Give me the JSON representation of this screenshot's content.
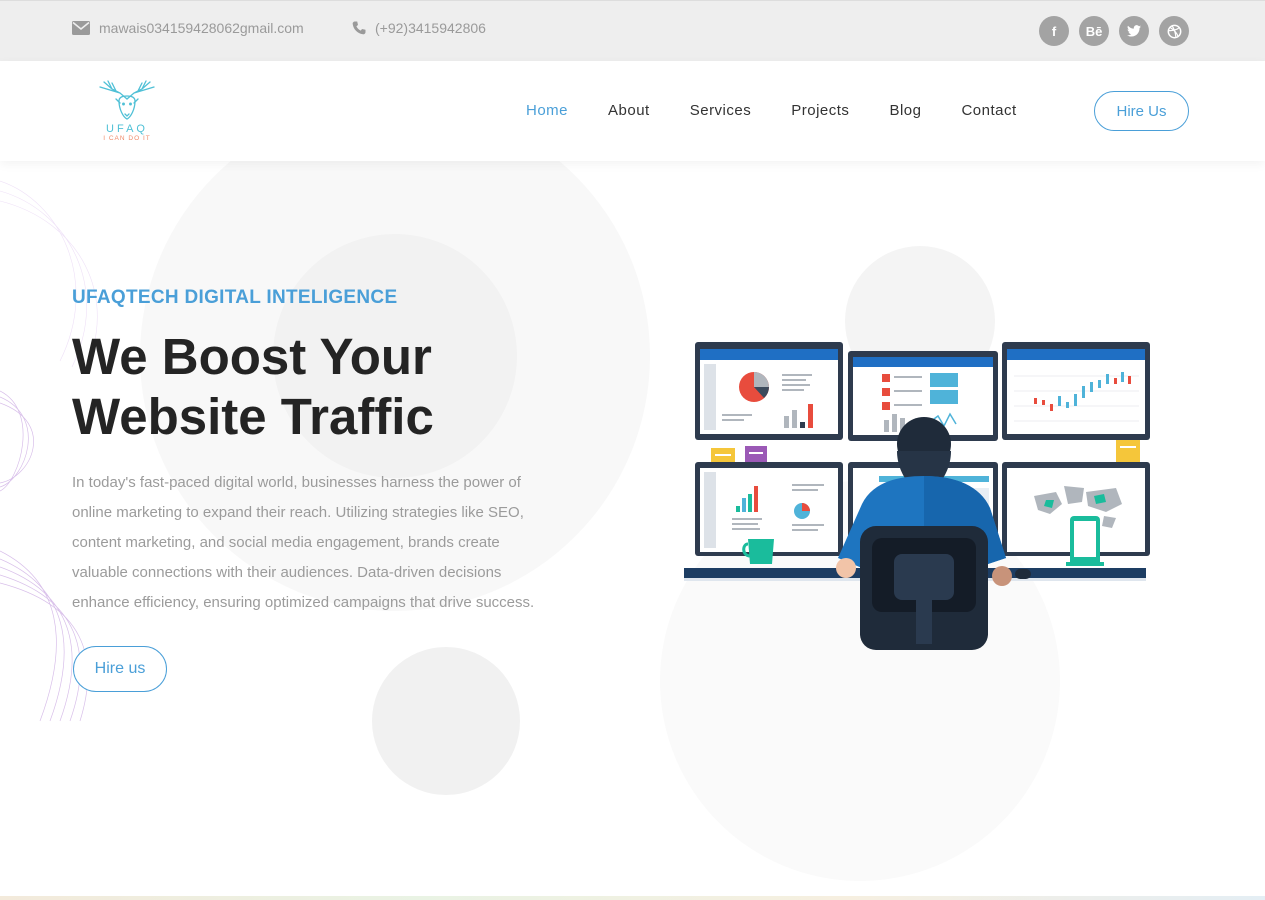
{
  "topbar": {
    "email": "mawais034159428062gmail.com",
    "phone": "(+92)3415942806",
    "socials": [
      {
        "name": "facebook",
        "glyph": "f"
      },
      {
        "name": "behance",
        "glyph": "Bē"
      },
      {
        "name": "twitter",
        "glyph": ""
      },
      {
        "name": "dribbble",
        "glyph": ""
      }
    ]
  },
  "header": {
    "logo": {
      "word": "UFAQ",
      "tagline": "I CAN DO IT"
    },
    "nav": [
      "Home",
      "About",
      "Services",
      "Projects",
      "Blog",
      "Contact"
    ],
    "active_nav": "Home",
    "cta": "Hire Us"
  },
  "hero": {
    "eyebrow": "UFAQTECH DIGITAL INTELIGENCE",
    "headline_line1": "We Boost Your",
    "headline_line2": "Website Traffic",
    "body": "In today's fast-paced digital world, businesses harness the power of online marketing to expand their reach. Utilizing strategies like SEO, content marketing, and social media engagement, brands create valuable connections with their audiences. Data-driven decisions enhance efficiency, ensuring optimized campaigns that drive success.",
    "cta": "Hire us"
  },
  "colors": {
    "accent": "#4a9fd8",
    "heading": "#242424",
    "topbar_bg": "#eeeeee",
    "social_bg": "#a3a3a3"
  }
}
